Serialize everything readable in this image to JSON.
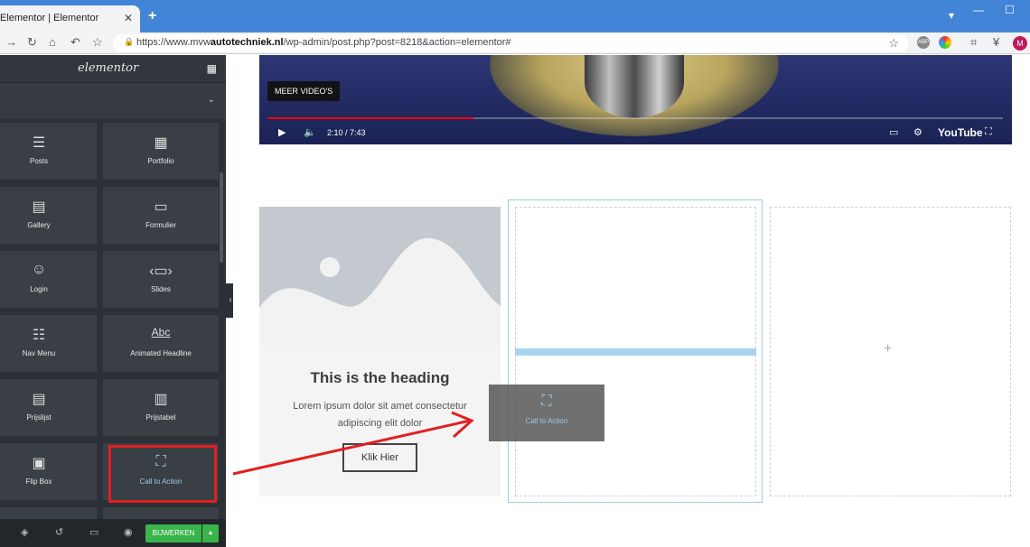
{
  "browser": {
    "tab_title": "Elementor | Elementor",
    "tab_close": "✕",
    "new_tab": "+",
    "url_prefix": "https://www.mvw",
    "url_domain": "autotechniek.nl",
    "url_path": "/wp-admin/post.php?post=8218&action=elementor#",
    "profile_initial": "M",
    "ext_abp": "ABP"
  },
  "sidebar": {
    "logo": "elementor",
    "widgets": [
      {
        "label": "Posts",
        "icon": "posts-icon"
      },
      {
        "label": "Portfolio",
        "icon": "portfolio-icon"
      },
      {
        "label": "Gallery",
        "icon": "gallery-icon"
      },
      {
        "label": "Formulier",
        "icon": "form-icon"
      },
      {
        "label": "Login",
        "icon": "login-icon"
      },
      {
        "label": "Slides",
        "icon": "slides-icon"
      },
      {
        "label": "Nav Menu",
        "icon": "nav-menu-icon"
      },
      {
        "label": "Animated Headline",
        "icon": "animated-headline-icon"
      },
      {
        "label": "Prijslijst",
        "icon": "price-list-icon"
      },
      {
        "label": "Prijstabel",
        "icon": "price-table-icon"
      },
      {
        "label": "Flip Box",
        "icon": "flip-box-icon"
      },
      {
        "label": "Call to Action",
        "icon": "call-to-action-icon"
      }
    ],
    "update_button": "BIJWERKEN",
    "animated_icon_text": "Abc"
  },
  "video": {
    "meer_label": "MEER VIDEO'S",
    "time": "2:10 / 7:43",
    "progress": 0.28,
    "youtube": "YouTube"
  },
  "cta": {
    "heading": "This is the heading",
    "description": "Lorem ipsum dolor sit amet consectetur adipiscing elit dolor",
    "button": "Klik Hier"
  },
  "drag_preview": {
    "label": "Call to Action"
  },
  "empty_column": {
    "plus": "+"
  },
  "colors": {
    "annotation": "#e02020",
    "update_green": "#39b54a",
    "drop_indicator": "#a6d3ef"
  }
}
